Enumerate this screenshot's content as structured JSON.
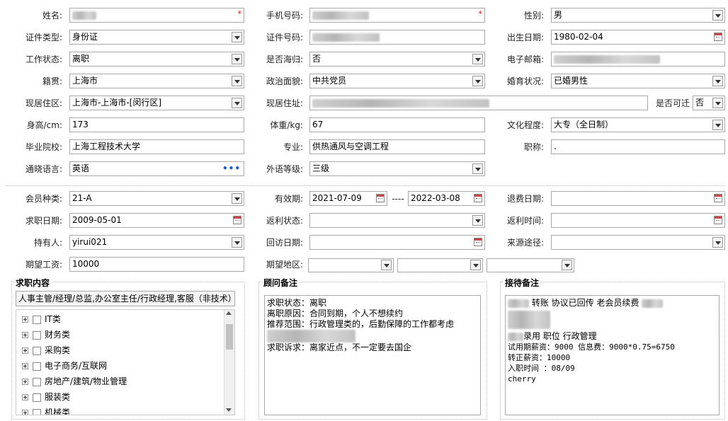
{
  "row1": {
    "name_label": "姓名:",
    "phone_label": "手机号码:",
    "gender_label": "性别:",
    "gender": "男",
    "required_mark": "*"
  },
  "row2": {
    "idtype_label": "证件类型:",
    "idtype": "身份证",
    "idno_label": "证件号码:",
    "birth_label": "出生日期:",
    "birth": "1980-02-04"
  },
  "row3": {
    "work_label": "工作状态:",
    "work": "离职",
    "returnee_label": "是否海归:",
    "returnee": "否",
    "email_label": "电子邮箱:"
  },
  "row4": {
    "native_label": "籍贯:",
    "native": "上海市",
    "political_label": "政治面貌:",
    "political": "中共党员",
    "marital_label": "婚育状况:",
    "marital": "已婚男性"
  },
  "row5": {
    "district_label": "现居住区:",
    "district": "上海市-上海市-[闵行区]",
    "address_label": "现居住址:",
    "relocate_label": "是否可迁",
    "relocate": "否"
  },
  "row6": {
    "height_label": "身高/cm:",
    "height": "173",
    "weight_label": "体重/kg:",
    "weight": "67",
    "edu_label": "文化程度:",
    "edu": "大专（全日制）"
  },
  "row7": {
    "school_label": "毕业院校:",
    "school": "上海工程技术大学",
    "major_label": "专业:",
    "major": "供热通风与空调工程",
    "title_label": "职称:",
    "title": "."
  },
  "row8": {
    "lang_label": "通晓语言:",
    "lang": "英语",
    "level_label": "外语等级:",
    "level": "三级",
    "more": "•••"
  },
  "member": {
    "type_label": "会员种类:",
    "type": "21-A",
    "valid_label": "有效期:",
    "valid_from": "2021-07-09",
    "dash": "----",
    "valid_to": "2022-03-08",
    "refund_label": "退费日期:",
    "jobdate_label": "求职日期:",
    "jobdate": "2009-05-01",
    "rebate_status_label": "返利状态:",
    "rebate_time_label": "返利时间:",
    "holder_label": "持有人:",
    "holder": "yirui021",
    "visit_label": "回访日期:",
    "source_label": "来源途径:",
    "salary_label": "期望工资:",
    "salary": "10000",
    "region_label": "期望地区:"
  },
  "job": {
    "title": "求职内容",
    "summary": "人事主管/经理/总监,办公室主任/行政经理,客服（非技术）",
    "items": [
      "IT类",
      "财务类",
      "采购类",
      "电子商务/互联网",
      "房地产/建筑/物业管理",
      "服装类",
      "机械类"
    ]
  },
  "consultant": {
    "title": "顾问备注",
    "lines": [
      "求职状态：离职",
      "离职原因：合同到期，个人不想续约",
      "推荐范围：行政管理类的，后勤保障的工作都考虑",
      "",
      "求职诉求：离家近点，不一定要去国企"
    ]
  },
  "reception": {
    "title": "接待备注",
    "line1": "转账 协议已回传  老会员续费",
    "line2": "录用 职位 行政管理",
    "line3": "试用期薪资：9000 信息费：9000*0.75=6750",
    "line4": "转正薪资：10000",
    "line5": "入职时间 ：08/09",
    "line6": "cherry"
  }
}
